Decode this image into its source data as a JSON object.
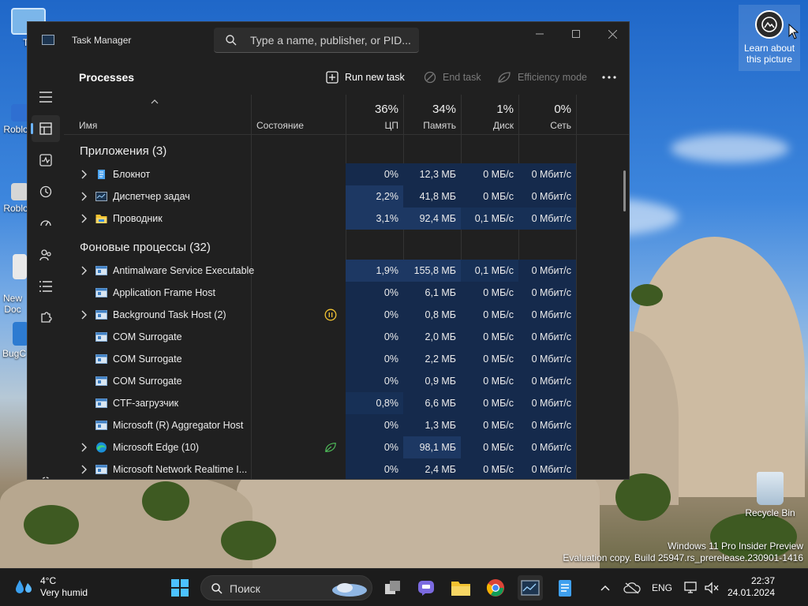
{
  "desktop": {
    "icons": [
      {
        "label": "Th"
      },
      {
        "label": "Roblo"
      },
      {
        "label": "Roblo"
      },
      {
        "label": "New\nDoc"
      },
      {
        "label": "BugC"
      }
    ],
    "learn_tile": {
      "label_line1": "Learn about",
      "label_line2": "this picture"
    },
    "recycle_bin": {
      "label": "Recycle Bin"
    },
    "watermark": {
      "line1": "Windows 11 Pro Insider Preview",
      "line2": "Evaluation copy. Build 25947.rs_prerelease.230901-1416"
    }
  },
  "window": {
    "title": "Task Manager",
    "search_placeholder": "Type a name, publisher, or PID..."
  },
  "toolbar": {
    "page_title": "Processes",
    "run_new_task": "Run new task",
    "end_task": "End task",
    "efficiency_mode": "Efficiency mode"
  },
  "columns": {
    "name": "Имя",
    "status": "Состояние",
    "cpu": {
      "pct": "36%",
      "label": "ЦП"
    },
    "memory": {
      "pct": "34%",
      "label": "Память"
    },
    "disk": {
      "pct": "1%",
      "label": "Диск"
    },
    "network": {
      "pct": "0%",
      "label": "Сеть"
    }
  },
  "groups": {
    "apps": "Приложения (3)",
    "background": "Фоновые процессы (32)"
  },
  "apps": [
    {
      "name": "Блокнот",
      "cpu": "0%",
      "mem": "12,3 МБ",
      "disk": "0 МБ/с",
      "net": "0 Мбит/с"
    },
    {
      "name": "Диспетчер задач",
      "cpu": "2,2%",
      "mem": "41,8 МБ",
      "disk": "0 МБ/с",
      "net": "0 Мбит/с"
    },
    {
      "name": "Проводник",
      "cpu": "3,1%",
      "mem": "92,4 МБ",
      "disk": "0,1 МБ/с",
      "net": "0 Мбит/с"
    }
  ],
  "background": [
    {
      "name": "Antimalware Service Executable",
      "cpu": "1,9%",
      "mem": "155,8 МБ",
      "disk": "0,1 МБ/с",
      "net": "0 Мбит/с"
    },
    {
      "name": "Application Frame Host",
      "cpu": "0%",
      "mem": "6,1 МБ",
      "disk": "0 МБ/с",
      "net": "0 Мбит/с"
    },
    {
      "name": "Background Task Host (2)",
      "cpu": "0%",
      "mem": "0,8 МБ",
      "disk": "0 МБ/с",
      "net": "0 Мбит/с"
    },
    {
      "name": "COM Surrogate",
      "cpu": "0%",
      "mem": "2,0 МБ",
      "disk": "0 МБ/с",
      "net": "0 Мбит/с"
    },
    {
      "name": "COM Surrogate",
      "cpu": "0%",
      "mem": "2,2 МБ",
      "disk": "0 МБ/с",
      "net": "0 Мбит/с"
    },
    {
      "name": "COM Surrogate",
      "cpu": "0%",
      "mem": "0,9 МБ",
      "disk": "0 МБ/с",
      "net": "0 Мбит/с"
    },
    {
      "name": "CTF-загрузчик",
      "cpu": "0,8%",
      "mem": "6,6 МБ",
      "disk": "0 МБ/с",
      "net": "0 Мбит/с"
    },
    {
      "name": "Microsoft (R) Aggregator Host",
      "cpu": "0%",
      "mem": "1,3 МБ",
      "disk": "0 МБ/с",
      "net": "0 Мбит/с"
    },
    {
      "name": "Microsoft Edge (10)",
      "cpu": "0%",
      "mem": "98,1 МБ",
      "disk": "0 МБ/с",
      "net": "0 Мбит/с"
    },
    {
      "name": "Microsoft Network Realtime I...",
      "cpu": "0%",
      "mem": "2,4 МБ",
      "disk": "0 МБ/с",
      "net": "0 Мбит/с"
    }
  ],
  "taskbar": {
    "weather_temp": "4°C",
    "weather_desc": "Very humid",
    "search_label": "Поиск",
    "language": "ENG",
    "time": "22:37",
    "date": "24.01.2024"
  },
  "colors": {
    "accent": "#6cb4ff",
    "heat_high": "#1d3863",
    "heat_mid": "#173056",
    "heat_low": "#152a4c"
  }
}
